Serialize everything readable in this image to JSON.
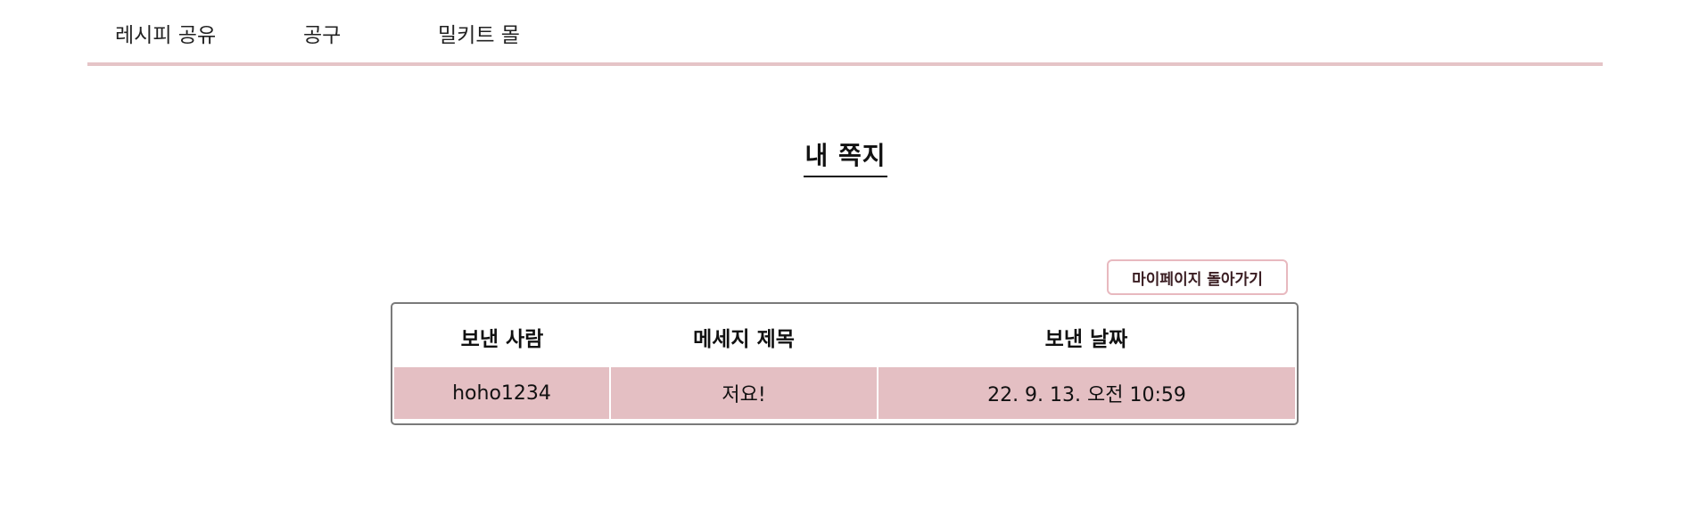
{
  "nav": {
    "items": [
      {
        "label": "레시피 공유"
      },
      {
        "label": "공구"
      },
      {
        "label": "밀키트 몰"
      }
    ]
  },
  "page": {
    "title": "내 쪽지"
  },
  "actions": {
    "back_label": "마이페이지 돌아가기"
  },
  "messages": {
    "headers": [
      "보낸 사람",
      "메세지 제목",
      "보낸 날짜"
    ],
    "rows": [
      {
        "sender": "hoho1234",
        "subject": "저요!",
        "date": "22. 9. 13. 오전 10:59"
      }
    ]
  },
  "colors": {
    "accent": "#e5c4c7",
    "row_background": "#e4bfc3",
    "button_border": "#e8b9bf"
  }
}
